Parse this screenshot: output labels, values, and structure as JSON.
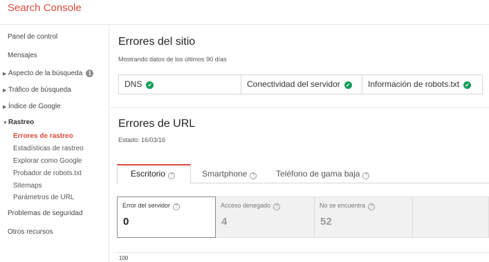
{
  "app": {
    "title": "Search Console"
  },
  "sidebar": {
    "items": [
      {
        "label": "Panel de control"
      },
      {
        "label": "Mensajes"
      },
      {
        "label": "Aspecto de la búsqueda"
      },
      {
        "label": "Tráfico de búsqueda"
      },
      {
        "label": "Índice de Google"
      },
      {
        "label": "Rastreo"
      },
      {
        "label": "Problemas de seguridad"
      },
      {
        "label": "Otros recursos"
      }
    ],
    "crawl_subitems": [
      {
        "label": "Errores de rastreo"
      },
      {
        "label": "Estadísticas de rastreo"
      },
      {
        "label": "Explorar como Google"
      },
      {
        "label": "Probador de robots.txt"
      },
      {
        "label": "Sitemaps"
      },
      {
        "label": "Parámetros de URL"
      }
    ]
  },
  "site_errors": {
    "title": "Errores del sitio",
    "subtitle": "Mostrando datos de los últimos 90 días",
    "checks": [
      {
        "label": "DNS",
        "status": "ok"
      },
      {
        "label": "Conectividad del servidor",
        "status": "ok"
      },
      {
        "label": "Información de robots.txt",
        "status": "ok"
      }
    ]
  },
  "url_errors": {
    "title": "Errores de URL",
    "status": "Estado: 16/03/16",
    "tabs": [
      {
        "label": "Escritorio",
        "active": true
      },
      {
        "label": "Smartphone",
        "active": false
      },
      {
        "label": "Teléfono de gama baja",
        "active": false
      }
    ],
    "metrics": [
      {
        "label": "Error del servidor",
        "value": "0",
        "active": true
      },
      {
        "label": "Acceso denegado",
        "value": "4",
        "active": false
      },
      {
        "label": "No se encuentra",
        "value": "52",
        "active": false
      }
    ],
    "chart_axis_top_label": "100"
  },
  "colors": {
    "brand": "#dd4b39",
    "ok": "#0f9d58"
  },
  "icons": {
    "check": "check-circle-icon",
    "help": "help-circle-icon",
    "info": "info-icon"
  }
}
